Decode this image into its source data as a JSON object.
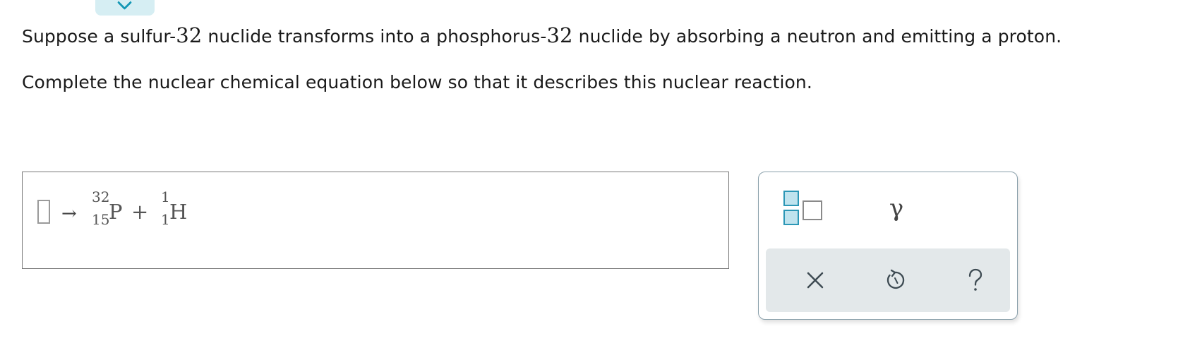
{
  "question": {
    "line1": {
      "a": "Suppose a sulfur-",
      "n1": "32",
      "b": " nuclide transforms into a phosphorus-",
      "n2": "32",
      "c": " nuclide by absorbing a neutron and emitting a proton."
    },
    "line2": "Complete the nuclear chemical equation below so that it describes this nuclear reaction."
  },
  "equation": {
    "arrow": "→",
    "product1": {
      "mass": "32",
      "atomic": "15",
      "symbol": "P"
    },
    "plus": "+",
    "product2": {
      "mass": "1",
      "atomic": "1",
      "symbol": "H"
    }
  },
  "palette": {
    "template_icon": "nuclide-template-icon",
    "gamma": "γ",
    "clear_icon": "close-icon",
    "undo_icon": "undo-icon",
    "help_icon": "help-icon"
  },
  "colors": {
    "accent": "#2c97b6",
    "tab_bg": "#d6eef3",
    "action_bar_bg": "#e3e8ea"
  }
}
